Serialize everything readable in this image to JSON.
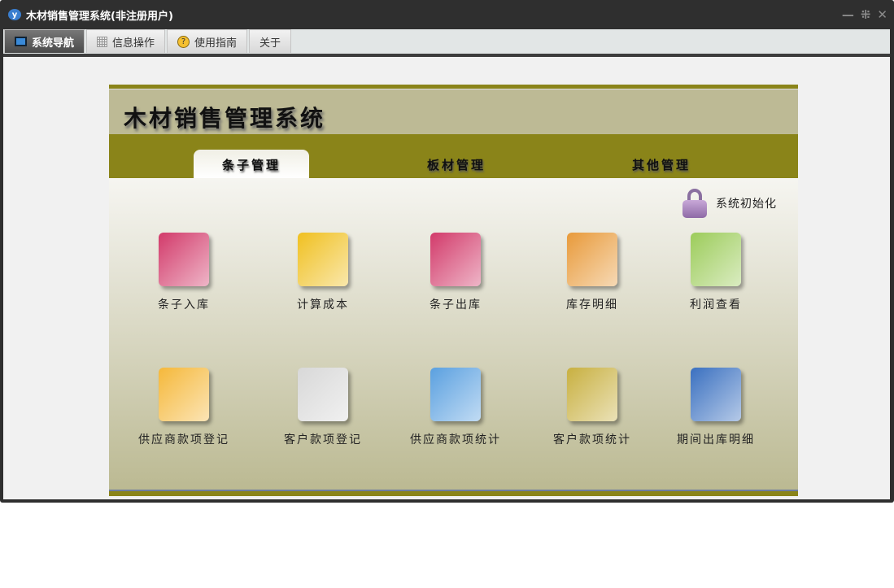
{
  "window": {
    "title": "木材销售管理系统(非注册用户)",
    "controls": [
      "—",
      "⁜",
      "✕"
    ]
  },
  "menu_tabs": [
    {
      "label": "系统导航",
      "icon": "monitor-icon"
    },
    {
      "label": "信息操作",
      "icon": "grid-icon"
    },
    {
      "label": "使用指南",
      "icon": "help-icon"
    },
    {
      "label": "关于"
    }
  ],
  "header": {
    "title": "木材销售管理系统"
  },
  "nav_tabs": [
    "条子管理",
    "板材管理",
    "其他管理"
  ],
  "init_label": "系统初始化",
  "items": [
    {
      "label": "条子入库",
      "icon": "folder-in-icon",
      "color": "#d23a6a"
    },
    {
      "label": "计算成本",
      "icon": "edit-document-icon",
      "color": "#f0c020"
    },
    {
      "label": "条子出库",
      "icon": "folder-out-icon",
      "color": "#d23a6a"
    },
    {
      "label": "库存明细",
      "icon": "boxes-icon",
      "color": "#e89a3a"
    },
    {
      "label": "利润查看",
      "icon": "book-icon",
      "color": "#9ccc5a"
    },
    {
      "label": "供应商款项登记",
      "icon": "notepad-pencil-icon",
      "color": "#f5b83a"
    },
    {
      "label": "客户款项登记",
      "icon": "paper-pen-icon",
      "color": "#d8d8d8"
    },
    {
      "label": "供应商款项统计",
      "icon": "books-folder-icon",
      "color": "#5aa0e0"
    },
    {
      "label": "客户款项统计",
      "icon": "notebook-icon",
      "color": "#c8b040"
    },
    {
      "label": "期间出库明细",
      "icon": "house-book-icon",
      "color": "#3a70c0"
    }
  ]
}
